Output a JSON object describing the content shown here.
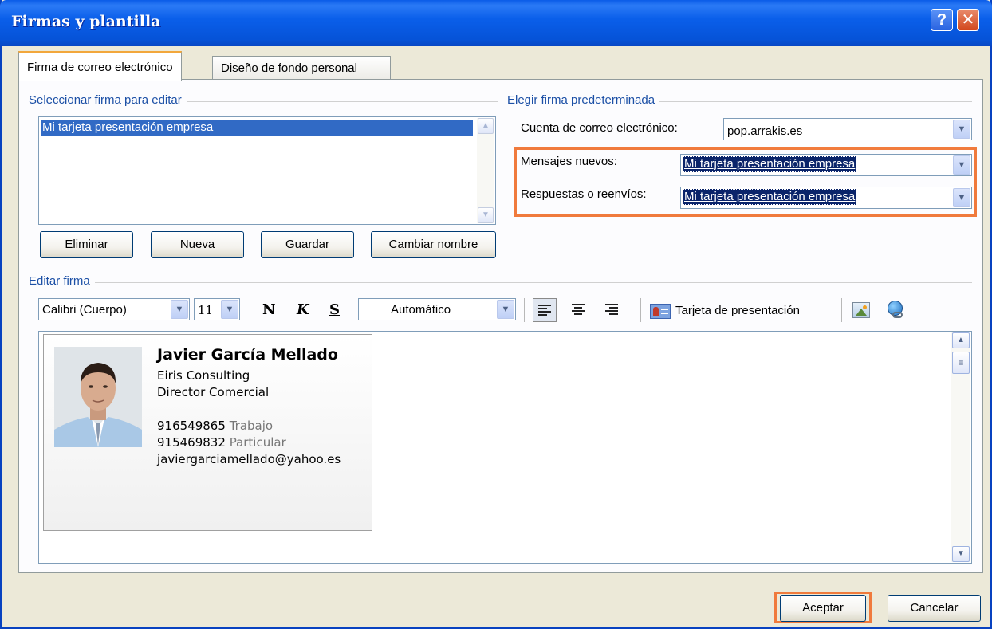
{
  "window": {
    "title": "Firmas y plantilla"
  },
  "tabs": [
    {
      "label": "Firma de correo electrónico"
    },
    {
      "label": "Diseño de fondo personal"
    }
  ],
  "select_group": {
    "title": "Seleccionar firma para editar",
    "items": [
      "Mi tarjeta presentación empresa"
    ],
    "buttons": {
      "delete": "Eliminar",
      "new": "Nueva",
      "save": "Guardar",
      "rename": "Cambiar nombre"
    }
  },
  "default_group": {
    "title": "Elegir firma predeterminada",
    "account_label": "Cuenta de correo electrónico:",
    "account_value": "pop.arrakis.es",
    "new_label": "Mensajes nuevos:",
    "new_value": "Mi tarjeta presentación empresa",
    "reply_label": "Respuestas o reenvíos:",
    "reply_value": "Mi tarjeta presentación empresa"
  },
  "edit_group": {
    "title": "Editar firma",
    "font": "Calibri (Cuerpo)",
    "size": "11",
    "bold": "N",
    "italic": "K",
    "underline": "S",
    "color": "Automático",
    "business_card": "Tarjeta de presentación"
  },
  "card": {
    "name": "Javier García Mellado",
    "company": "Eiris Consulting",
    "position": "Director Comercial",
    "phone_work": "916549865",
    "phone_work_label": "Trabajo",
    "phone_home": "915469832",
    "phone_home_label": "Particular",
    "email": "javiergarciamellado@yahoo.es"
  },
  "footer": {
    "ok": "Aceptar",
    "cancel": "Cancelar"
  },
  "colors": {
    "highlight": "#f07a3c",
    "selection": "#316ac5",
    "titlebar": "#0a5fea"
  }
}
